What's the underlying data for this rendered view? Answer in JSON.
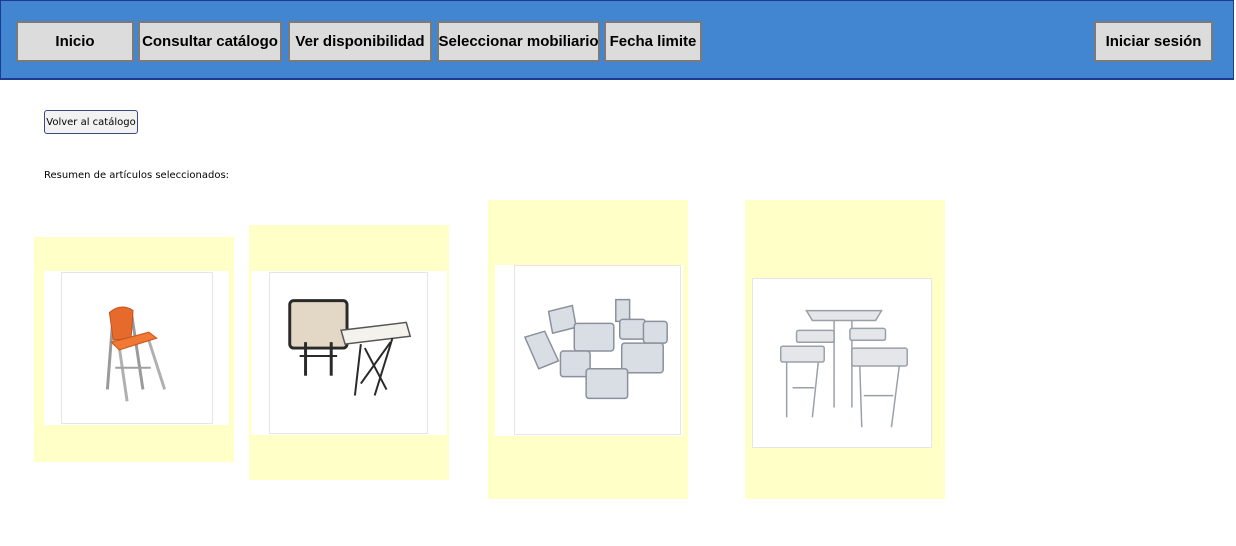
{
  "nav": {
    "inicio": "Inicio",
    "consultar": "Consultar catálogo",
    "ver": "Ver disponibilidad",
    "seleccionar": "Seleccionar mobiliario",
    "fecha": "Fecha limite",
    "login": "Iniciar sesión"
  },
  "back_button": "Volver al catálogo",
  "summary_label": "Resumen de artículos seleccionados:",
  "items": [
    {
      "icon": "folding-chair-image"
    },
    {
      "icon": "folding-table-set-image"
    },
    {
      "icon": "lounge-ottoman-set-image"
    },
    {
      "icon": "bar-table-stools-image"
    }
  ],
  "colors": {
    "navbar": "#4285d0",
    "card_background": "#ffffc8"
  }
}
